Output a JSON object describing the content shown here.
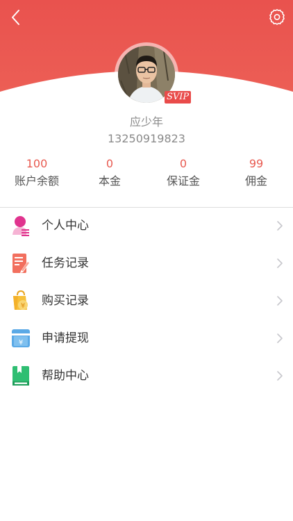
{
  "profile": {
    "name": "应少年",
    "phone": "13250919823",
    "badge": "SVIP"
  },
  "stats": [
    {
      "value": "100",
      "label": "账户余额"
    },
    {
      "value": "0",
      "label": "本金"
    },
    {
      "value": "0",
      "label": "保证金"
    },
    {
      "value": "99",
      "label": "佣金"
    }
  ],
  "menu": [
    {
      "label": "个人中心",
      "icon": "person-icon"
    },
    {
      "label": "任务记录",
      "icon": "task-record-icon"
    },
    {
      "label": "购买记录",
      "icon": "shopping-bag-icon"
    },
    {
      "label": "申请提现",
      "icon": "withdraw-card-icon"
    },
    {
      "label": "帮助中心",
      "icon": "help-book-icon"
    }
  ],
  "colors": {
    "header": "#ea5550",
    "accent": "#e8594f"
  }
}
